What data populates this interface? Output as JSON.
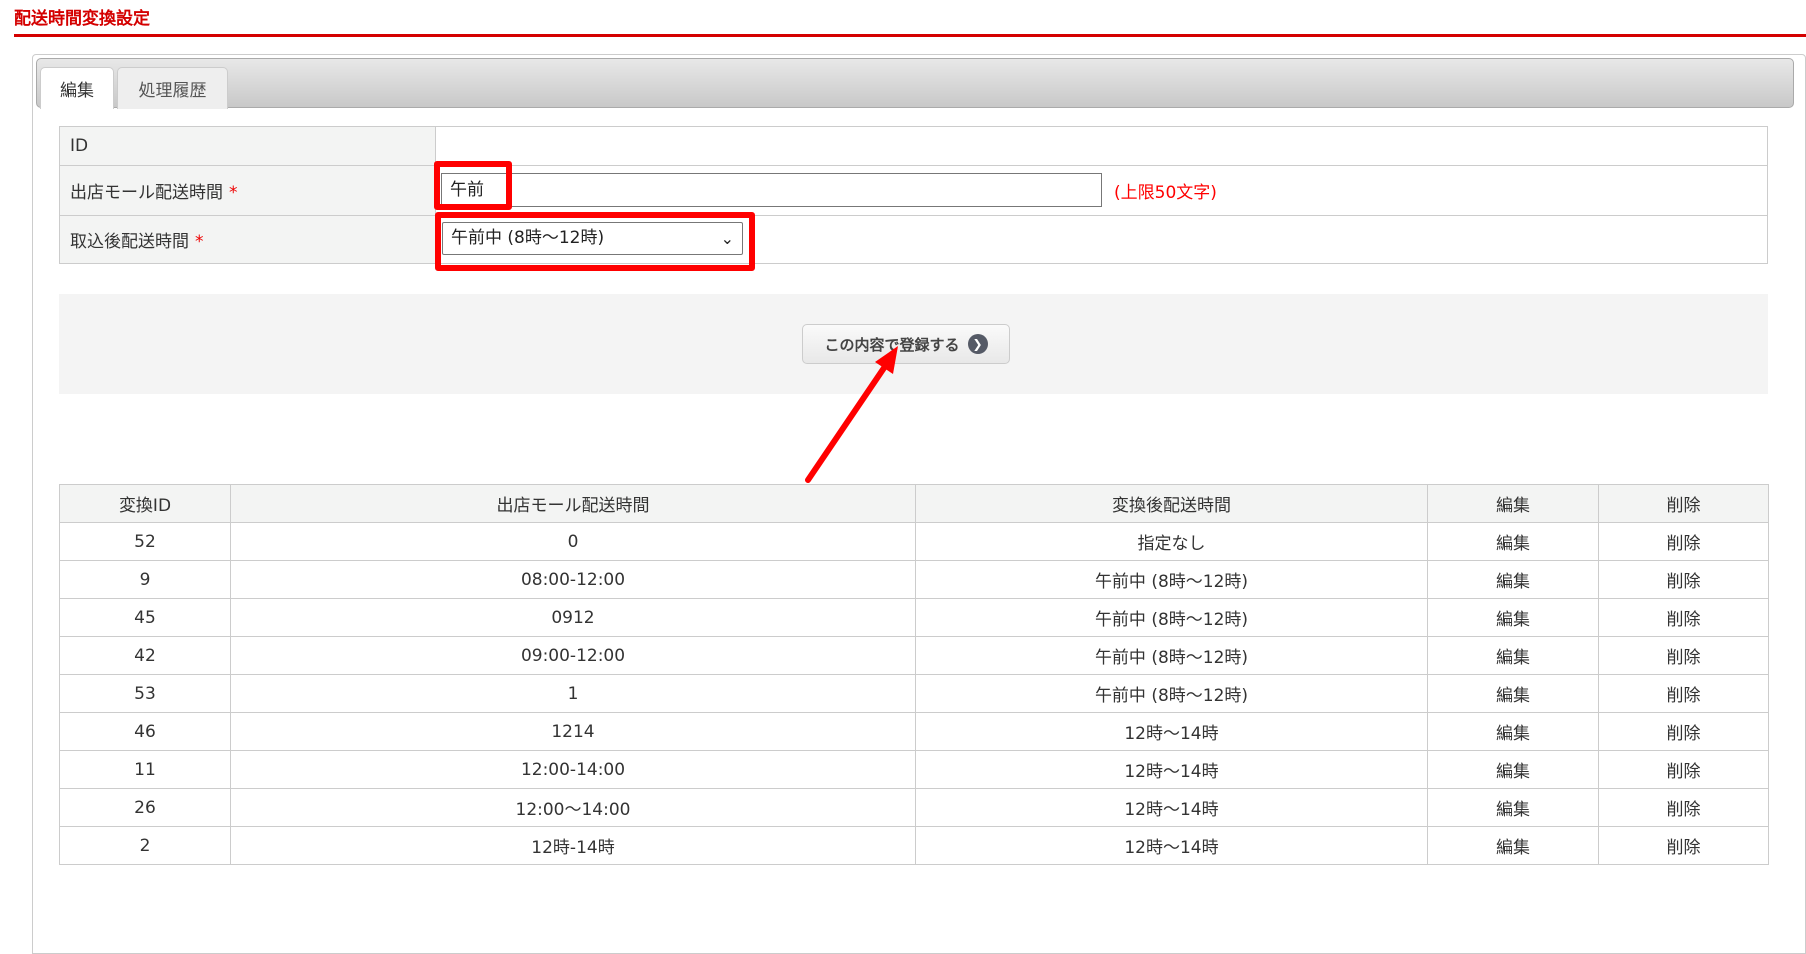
{
  "page_title": "配送時間変換設定",
  "tabs": [
    {
      "label": "編集",
      "active": true
    },
    {
      "label": "処理履歴",
      "active": false
    }
  ],
  "form": {
    "id_label": "ID",
    "id_value": "",
    "mall_time_label": "出店モール配送時間",
    "mall_time_value": "午前",
    "mall_time_note": "(上限50文字)",
    "converted_time_label": "取込後配送時間",
    "converted_time_value": "午前中 (8時〜12時)",
    "required_mark": "*"
  },
  "submit_label": "この内容で登録する",
  "table": {
    "headers": [
      "変換ID",
      "出店モール配送時間",
      "変換後配送時間",
      "編集",
      "削除"
    ],
    "rows": [
      {
        "id": "52",
        "mall": "0",
        "converted": "指定なし",
        "edit": "編集",
        "delete": "削除"
      },
      {
        "id": "9",
        "mall": "08:00-12:00",
        "converted": "午前中 (8時〜12時)",
        "edit": "編集",
        "delete": "削除"
      },
      {
        "id": "45",
        "mall": "0912",
        "converted": "午前中 (8時〜12時)",
        "edit": "編集",
        "delete": "削除"
      },
      {
        "id": "42",
        "mall": "09:00-12:00",
        "converted": "午前中 (8時〜12時)",
        "edit": "編集",
        "delete": "削除"
      },
      {
        "id": "53",
        "mall": "1",
        "converted": "午前中 (8時〜12時)",
        "edit": "編集",
        "delete": "削除"
      },
      {
        "id": "46",
        "mall": "1214",
        "converted": "12時〜14時",
        "edit": "編集",
        "delete": "削除"
      },
      {
        "id": "11",
        "mall": "12:00-14:00",
        "converted": "12時〜14時",
        "edit": "編集",
        "delete": "削除"
      },
      {
        "id": "26",
        "mall": "12:00〜14:00",
        "converted": "12時〜14時",
        "edit": "編集",
        "delete": "削除"
      },
      {
        "id": "2",
        "mall": "12時-14時",
        "converted": "12時〜14時",
        "edit": "編集",
        "delete": "削除"
      }
    ]
  },
  "colors": {
    "accent": "#d40000",
    "highlight": "#ff0000"
  }
}
